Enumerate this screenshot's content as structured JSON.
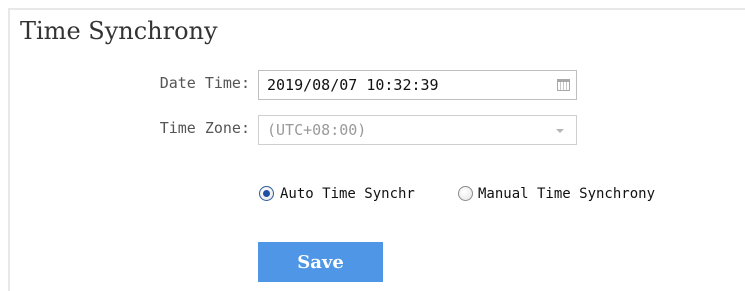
{
  "title": "Time Synchrony",
  "date_time": {
    "label": "Date Time:",
    "value": "2019/08/07 10:32:39",
    "icon": "calendar-icon"
  },
  "time_zone": {
    "label": "Time Zone:",
    "value": "(UTC+08:00)",
    "disabled": true,
    "icon": "chevron-down-icon"
  },
  "sync_mode": {
    "selected": "auto",
    "options": [
      {
        "id": "auto",
        "label": "Auto Time Synchr"
      },
      {
        "id": "manual",
        "label": "Manual Time Synchrony"
      }
    ]
  },
  "save_label": "Save",
  "colors": {
    "accent": "#4f97e6",
    "radio_checked": "#1f4fa3",
    "border": "#e8e8e8"
  }
}
